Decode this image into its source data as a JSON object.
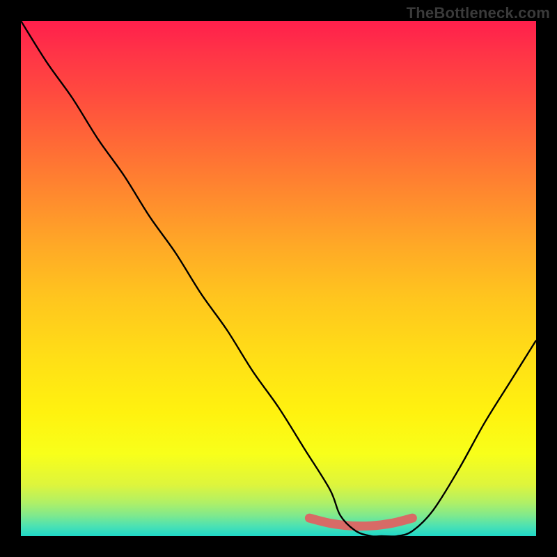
{
  "watermark": "TheBottleneck.com",
  "chart_data": {
    "type": "line",
    "title": "",
    "xlabel": "",
    "ylabel": "",
    "xlim": [
      0,
      100
    ],
    "ylim": [
      0,
      100
    ],
    "grid": false,
    "series": [
      {
        "name": "bottleneck-curve",
        "x": [
          0,
          5,
          10,
          15,
          20,
          25,
          30,
          35,
          40,
          45,
          50,
          55,
          60,
          62,
          65,
          68,
          70,
          73,
          76,
          80,
          85,
          90,
          95,
          100
        ],
        "values": [
          100,
          92,
          85,
          77,
          70,
          62,
          55,
          47,
          40,
          32,
          25,
          17,
          9,
          4,
          1,
          0,
          0,
          0,
          1,
          5,
          13,
          22,
          30,
          38
        ]
      },
      {
        "name": "green-band",
        "x": [
          56,
          60,
          64,
          68,
          72,
          76
        ],
        "values": [
          3.5,
          2.5,
          2,
          2,
          2.5,
          3.5
        ]
      }
    ],
    "colors": {
      "curve": "#000000",
      "band": "#d86a66",
      "gradient_top": "#ff1f4c",
      "gradient_bottom": "#1fd8c8"
    }
  }
}
